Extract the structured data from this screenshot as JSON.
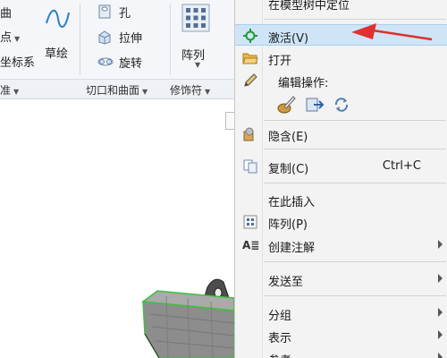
{
  "ribbon": {
    "frag_top": "曲",
    "frag_point": "点",
    "frag_coord": "坐标系",
    "sketch": "草绘",
    "hole": "孔",
    "extrude": "拉伸",
    "revolve": "旋转",
    "pattern": "阵列",
    "groups": {
      "frag_datum": "准",
      "cut_surface": "切口和曲面",
      "modifier": "修饰符"
    }
  },
  "context_menu": {
    "top_partial": "在模型树中定位",
    "items": [
      {
        "label": "激活(V)",
        "icon": "activate-crosshair-icon",
        "highlighted": true
      },
      {
        "label": "打开",
        "icon": "folder-open-icon"
      },
      {
        "label": "编辑操作:",
        "icon": "pencil-icon"
      },
      {
        "label": "隐含(E)",
        "icon": "suppress-icon"
      },
      {
        "label": "复制(C)",
        "icon": "copy-icon",
        "shortcut": "Ctrl+C"
      },
      {
        "label": "在此插入"
      },
      {
        "label": "阵列(P)",
        "icon": "pattern-icon"
      },
      {
        "label": "创建注解",
        "icon": "annotation-icon",
        "submenu": true
      },
      {
        "label": "发送至",
        "submenu": true
      },
      {
        "label": "分组",
        "submenu": true
      },
      {
        "label": "表示",
        "submenu": true
      },
      {
        "label": "参考",
        "submenu": true
      }
    ]
  },
  "colors": {
    "arrow": "#e03030",
    "highlight": "#cfe5f7",
    "model_green": "#3fbf3f"
  }
}
